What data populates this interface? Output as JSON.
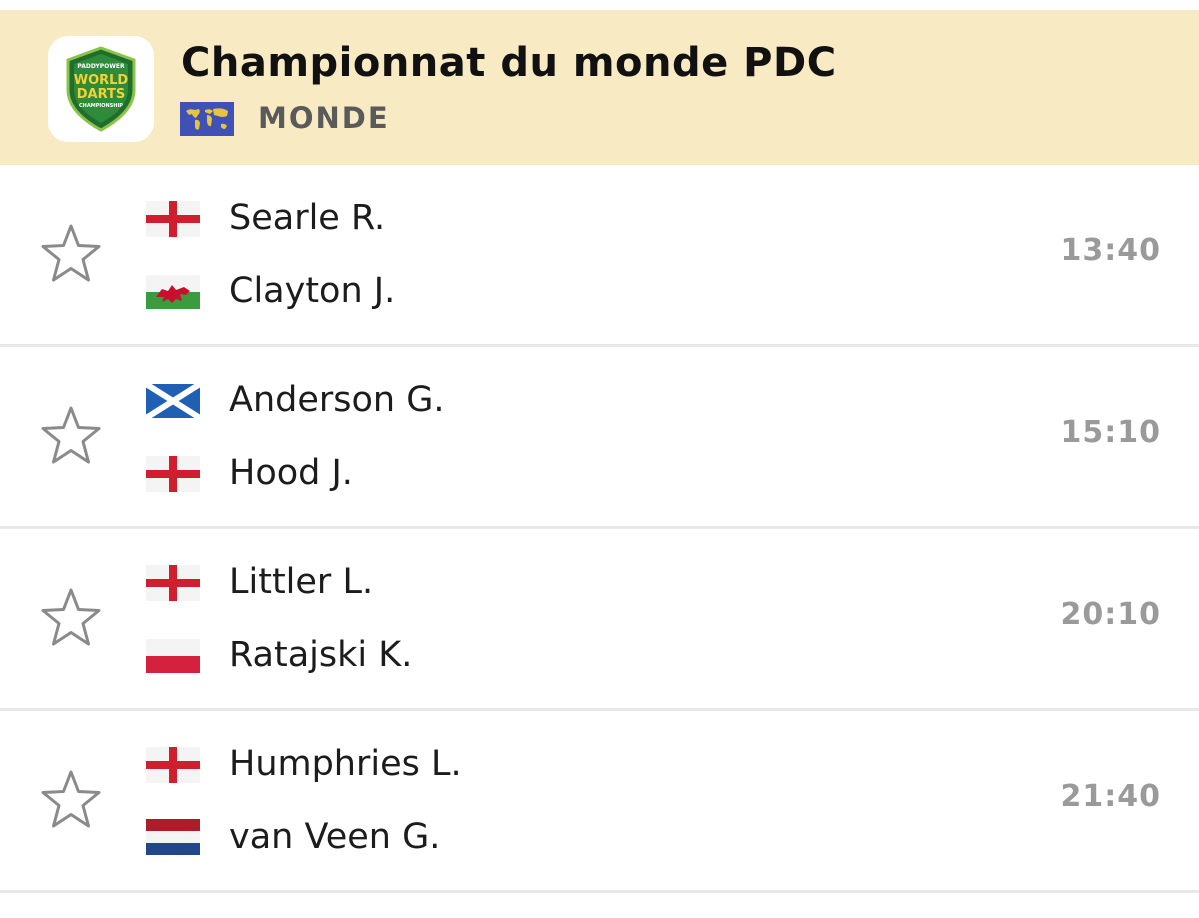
{
  "league": {
    "name": "Championnat du monde PDC",
    "country": "MONDE",
    "logo_icon": "world-darts-championship-logo",
    "logo_text": [
      "PADDYPOWER",
      "WORLD",
      "DARTS",
      "CHAMPIONSHIP"
    ]
  },
  "matches": [
    {
      "home": {
        "name": "Searle R.",
        "flag": "england"
      },
      "away": {
        "name": "Clayton J.",
        "flag": "wales"
      },
      "time": "13:40"
    },
    {
      "home": {
        "name": "Anderson G.",
        "flag": "scotland"
      },
      "away": {
        "name": "Hood J.",
        "flag": "england"
      },
      "time": "15:10"
    },
    {
      "home": {
        "name": "Littler L.",
        "flag": "england"
      },
      "away": {
        "name": "Ratajski K.",
        "flag": "poland"
      },
      "time": "20:10"
    },
    {
      "home": {
        "name": "Humphries L.",
        "flag": "england"
      },
      "away": {
        "name": "van Veen G.",
        "flag": "netherlands"
      },
      "time": "21:40"
    }
  ],
  "colors": {
    "header_bg": "#f8ebc4",
    "time_text": "#9a9a9a",
    "divider": "#e8e8e8"
  }
}
